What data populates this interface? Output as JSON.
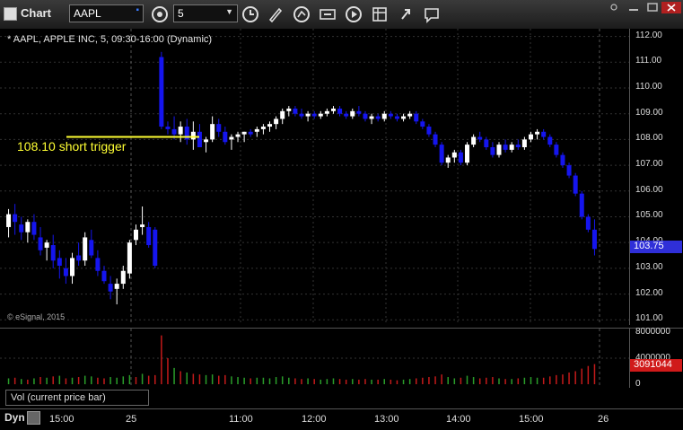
{
  "app_title": "Chart",
  "toolbar": {
    "symbol_value": "AAPL",
    "interval_value": "5",
    "icons": [
      "clock-refresh-icon",
      "clock-icon",
      "pencil-icon",
      "cursor-icon",
      "goto-icon",
      "play-icon",
      "template-icon",
      "chat-icon"
    ]
  },
  "chart": {
    "header": "* AAPL, APPLE INC, 5, 09:30-16:00 (Dynamic)",
    "watermark": "© eSignal, 2015",
    "annotation": "108.10 short trigger",
    "price_ticks": [
      "112.00",
      "111.00",
      "110.00",
      "109.00",
      "108.00",
      "107.00",
      "106.00",
      "105.00",
      "104.00",
      "103.00",
      "102.00",
      "101.00"
    ],
    "last_price": "103.75",
    "time_ticks": [
      "15:00",
      "25",
      "11:00",
      "12:00",
      "13:00",
      "14:00",
      "15:00",
      "26"
    ],
    "volume_label": "Vol (current price bar)",
    "vol_ticks": [
      "8000000",
      "4000000",
      "0"
    ],
    "last_volume": "3091044",
    "footer_left": "Dyn",
    "colors": {
      "up": "#ffffff",
      "down": "#1515ee",
      "annotation": "#ffff33",
      "grid": "#333333",
      "vol_up": "#2a9e2a",
      "vol_down": "#c41a1a"
    }
  },
  "chart_data": {
    "type": "candlestick",
    "title": "AAPL, APPLE INC, 5, 09:30-16:00 (Dynamic)",
    "ylim": [
      100.8,
      112.3
    ],
    "annotation_level": 108.1,
    "candles": [
      [
        104.6,
        105.3,
        104.2,
        105.1
      ],
      [
        105.1,
        105.5,
        104.3,
        104.8
      ],
      [
        104.7,
        105.0,
        104.1,
        104.4
      ],
      [
        104.4,
        104.9,
        104.0,
        104.8
      ],
      [
        104.8,
        105.1,
        104.1,
        104.3
      ],
      [
        104.2,
        104.6,
        103.5,
        103.7
      ],
      [
        103.8,
        104.1,
        103.3,
        104.0
      ],
      [
        103.9,
        104.3,
        103.0,
        103.3
      ],
      [
        103.4,
        103.7,
        102.6,
        103.1
      ],
      [
        103.0,
        103.4,
        102.4,
        102.7
      ],
      [
        102.7,
        103.6,
        102.4,
        103.4
      ],
      [
        103.5,
        104.0,
        103.1,
        103.3
      ],
      [
        103.3,
        104.4,
        103.1,
        104.2
      ],
      [
        104.1,
        104.5,
        103.4,
        103.5
      ],
      [
        103.4,
        103.7,
        102.7,
        102.9
      ],
      [
        102.9,
        103.1,
        102.4,
        102.5
      ],
      [
        102.4,
        102.7,
        101.8,
        102.1
      ],
      [
        102.2,
        102.6,
        101.6,
        102.4
      ],
      [
        102.4,
        103.1,
        102.2,
        102.9
      ],
      [
        102.8,
        104.1,
        102.6,
        104.0
      ],
      [
        104.1,
        104.7,
        103.9,
        104.5
      ],
      [
        104.6,
        105.4,
        104.3,
        104.7
      ],
      [
        104.6,
        104.8,
        103.8,
        103.9
      ],
      [
        104.5,
        104.6,
        103.0,
        103.1
      ],
      [
        111.2,
        111.4,
        108.4,
        108.5
      ],
      [
        108.5,
        108.7,
        108.2,
        108.4
      ],
      [
        108.4,
        108.9,
        108.0,
        108.2
      ],
      [
        108.2,
        108.7,
        107.9,
        108.5
      ],
      [
        108.5,
        108.8,
        107.8,
        108.0
      ],
      [
        108.0,
        108.7,
        107.6,
        108.3
      ],
      [
        108.3,
        108.6,
        107.8,
        107.7
      ],
      [
        107.9,
        108.1,
        107.5,
        108.0
      ],
      [
        108.0,
        108.9,
        107.9,
        108.6
      ],
      [
        108.6,
        108.8,
        108.1,
        108.3
      ],
      [
        108.3,
        108.5,
        107.8,
        107.9
      ],
      [
        108.0,
        108.2,
        107.6,
        108.1
      ],
      [
        108.1,
        108.3,
        107.9,
        108.2
      ],
      [
        108.2,
        108.3,
        107.9,
        108.3
      ],
      [
        108.3,
        108.4,
        108.1,
        108.2
      ],
      [
        108.3,
        108.5,
        108.1,
        108.4
      ],
      [
        108.4,
        108.6,
        108.2,
        108.5
      ],
      [
        108.5,
        108.7,
        108.3,
        108.6
      ],
      [
        108.6,
        108.9,
        108.4,
        108.8
      ],
      [
        108.8,
        109.2,
        108.6,
        109.1
      ],
      [
        109.1,
        109.3,
        108.9,
        109.2
      ],
      [
        109.2,
        109.3,
        108.9,
        109.0
      ],
      [
        109.0,
        109.2,
        108.8,
        108.9
      ],
      [
        108.9,
        109.1,
        108.7,
        109.0
      ],
      [
        109.0,
        109.1,
        108.8,
        108.9
      ],
      [
        108.9,
        109.1,
        108.8,
        109.0
      ],
      [
        109.0,
        109.2,
        108.9,
        109.1
      ],
      [
        109.1,
        109.3,
        109.0,
        109.2
      ],
      [
        109.2,
        109.3,
        108.9,
        109.0
      ],
      [
        109.0,
        109.1,
        108.8,
        108.9
      ],
      [
        108.9,
        109.2,
        108.8,
        109.1
      ],
      [
        109.1,
        109.3,
        108.9,
        109.0
      ],
      [
        109.0,
        109.1,
        108.7,
        108.8
      ],
      [
        108.8,
        109.0,
        108.6,
        108.9
      ],
      [
        108.9,
        109.0,
        108.7,
        108.8
      ],
      [
        108.8,
        109.1,
        108.7,
        109.0
      ],
      [
        109.0,
        109.1,
        108.8,
        108.9
      ],
      [
        108.9,
        109.0,
        108.7,
        108.8
      ],
      [
        108.8,
        109.0,
        108.7,
        108.9
      ],
      [
        108.9,
        109.1,
        108.8,
        109.0
      ],
      [
        109.0,
        109.1,
        108.6,
        108.7
      ],
      [
        108.7,
        108.8,
        108.4,
        108.5
      ],
      [
        108.5,
        108.6,
        108.1,
        108.2
      ],
      [
        108.2,
        108.3,
        107.7,
        107.8
      ],
      [
        107.8,
        107.9,
        107.0,
        107.1
      ],
      [
        107.1,
        107.4,
        106.9,
        107.3
      ],
      [
        107.3,
        107.6,
        107.1,
        107.5
      ],
      [
        107.5,
        107.6,
        107.0,
        107.1
      ],
      [
        107.1,
        107.9,
        107.0,
        107.8
      ],
      [
        107.8,
        108.2,
        107.7,
        108.1
      ],
      [
        108.1,
        108.3,
        107.9,
        108.0
      ],
      [
        108.0,
        108.1,
        107.6,
        107.7
      ],
      [
        107.7,
        107.9,
        107.3,
        107.4
      ],
      [
        107.4,
        107.9,
        107.3,
        107.8
      ],
      [
        107.8,
        108.0,
        107.5,
        107.6
      ],
      [
        107.6,
        107.9,
        107.5,
        107.8
      ],
      [
        107.8,
        108.0,
        107.6,
        107.7
      ],
      [
        107.7,
        108.1,
        107.6,
        108.0
      ],
      [
        108.0,
        108.3,
        107.9,
        108.2
      ],
      [
        108.2,
        108.4,
        108.0,
        108.3
      ],
      [
        108.3,
        108.4,
        108.0,
        108.1
      ],
      [
        108.1,
        108.2,
        107.7,
        107.8
      ],
      [
        107.8,
        107.9,
        107.3,
        107.4
      ],
      [
        107.4,
        107.5,
        106.9,
        107.0
      ],
      [
        107.0,
        107.1,
        106.5,
        106.6
      ],
      [
        106.6,
        106.7,
        105.8,
        105.9
      ],
      [
        105.9,
        106.0,
        104.9,
        105.0
      ],
      [
        105.0,
        105.1,
        104.4,
        104.5
      ],
      [
        104.5,
        104.9,
        103.5,
        103.75
      ]
    ],
    "volume_ylim": [
      0,
      8000000
    ],
    "volume": [
      [
        900000,
        "up"
      ],
      [
        1000000,
        "down"
      ],
      [
        800000,
        "up"
      ],
      [
        700000,
        "down"
      ],
      [
        900000,
        "up"
      ],
      [
        1100000,
        "down"
      ],
      [
        1000000,
        "up"
      ],
      [
        1200000,
        "down"
      ],
      [
        1300000,
        "up"
      ],
      [
        900000,
        "down"
      ],
      [
        1000000,
        "up"
      ],
      [
        1100000,
        "down"
      ],
      [
        1300000,
        "up"
      ],
      [
        1200000,
        "up"
      ],
      [
        1000000,
        "down"
      ],
      [
        900000,
        "down"
      ],
      [
        1100000,
        "up"
      ],
      [
        1000000,
        "up"
      ],
      [
        1200000,
        "up"
      ],
      [
        1400000,
        "up"
      ],
      [
        1100000,
        "down"
      ],
      [
        1600000,
        "up"
      ],
      [
        1300000,
        "down"
      ],
      [
        1400000,
        "down"
      ],
      [
        7500000,
        "down"
      ],
      [
        4000000,
        "down"
      ],
      [
        2500000,
        "up"
      ],
      [
        2000000,
        "down"
      ],
      [
        1800000,
        "up"
      ],
      [
        1600000,
        "down"
      ],
      [
        1500000,
        "down"
      ],
      [
        1400000,
        "up"
      ],
      [
        1500000,
        "up"
      ],
      [
        1300000,
        "down"
      ],
      [
        1400000,
        "down"
      ],
      [
        1200000,
        "up"
      ],
      [
        1100000,
        "up"
      ],
      [
        1000000,
        "up"
      ],
      [
        900000,
        "down"
      ],
      [
        1000000,
        "up"
      ],
      [
        1000000,
        "up"
      ],
      [
        900000,
        "up"
      ],
      [
        1100000,
        "up"
      ],
      [
        1200000,
        "up"
      ],
      [
        1000000,
        "up"
      ],
      [
        900000,
        "down"
      ],
      [
        800000,
        "down"
      ],
      [
        900000,
        "up"
      ],
      [
        800000,
        "down"
      ],
      [
        700000,
        "up"
      ],
      [
        800000,
        "up"
      ],
      [
        900000,
        "up"
      ],
      [
        800000,
        "down"
      ],
      [
        700000,
        "down"
      ],
      [
        800000,
        "up"
      ],
      [
        700000,
        "down"
      ],
      [
        800000,
        "down"
      ],
      [
        700000,
        "up"
      ],
      [
        700000,
        "down"
      ],
      [
        800000,
        "up"
      ],
      [
        700000,
        "down"
      ],
      [
        600000,
        "down"
      ],
      [
        700000,
        "up"
      ],
      [
        800000,
        "up"
      ],
      [
        900000,
        "down"
      ],
      [
        1000000,
        "down"
      ],
      [
        1100000,
        "down"
      ],
      [
        1200000,
        "down"
      ],
      [
        1500000,
        "down"
      ],
      [
        1100000,
        "up"
      ],
      [
        900000,
        "up"
      ],
      [
        1000000,
        "down"
      ],
      [
        1300000,
        "up"
      ],
      [
        1100000,
        "up"
      ],
      [
        900000,
        "down"
      ],
      [
        1000000,
        "down"
      ],
      [
        1100000,
        "down"
      ],
      [
        900000,
        "up"
      ],
      [
        800000,
        "down"
      ],
      [
        800000,
        "up"
      ],
      [
        900000,
        "down"
      ],
      [
        1000000,
        "up"
      ],
      [
        1100000,
        "up"
      ],
      [
        1000000,
        "up"
      ],
      [
        1000000,
        "down"
      ],
      [
        1200000,
        "down"
      ],
      [
        1400000,
        "down"
      ],
      [
        1500000,
        "down"
      ],
      [
        1800000,
        "down"
      ],
      [
        2000000,
        "down"
      ],
      [
        2400000,
        "down"
      ],
      [
        2800000,
        "down"
      ],
      [
        3091044,
        "down"
      ]
    ]
  }
}
